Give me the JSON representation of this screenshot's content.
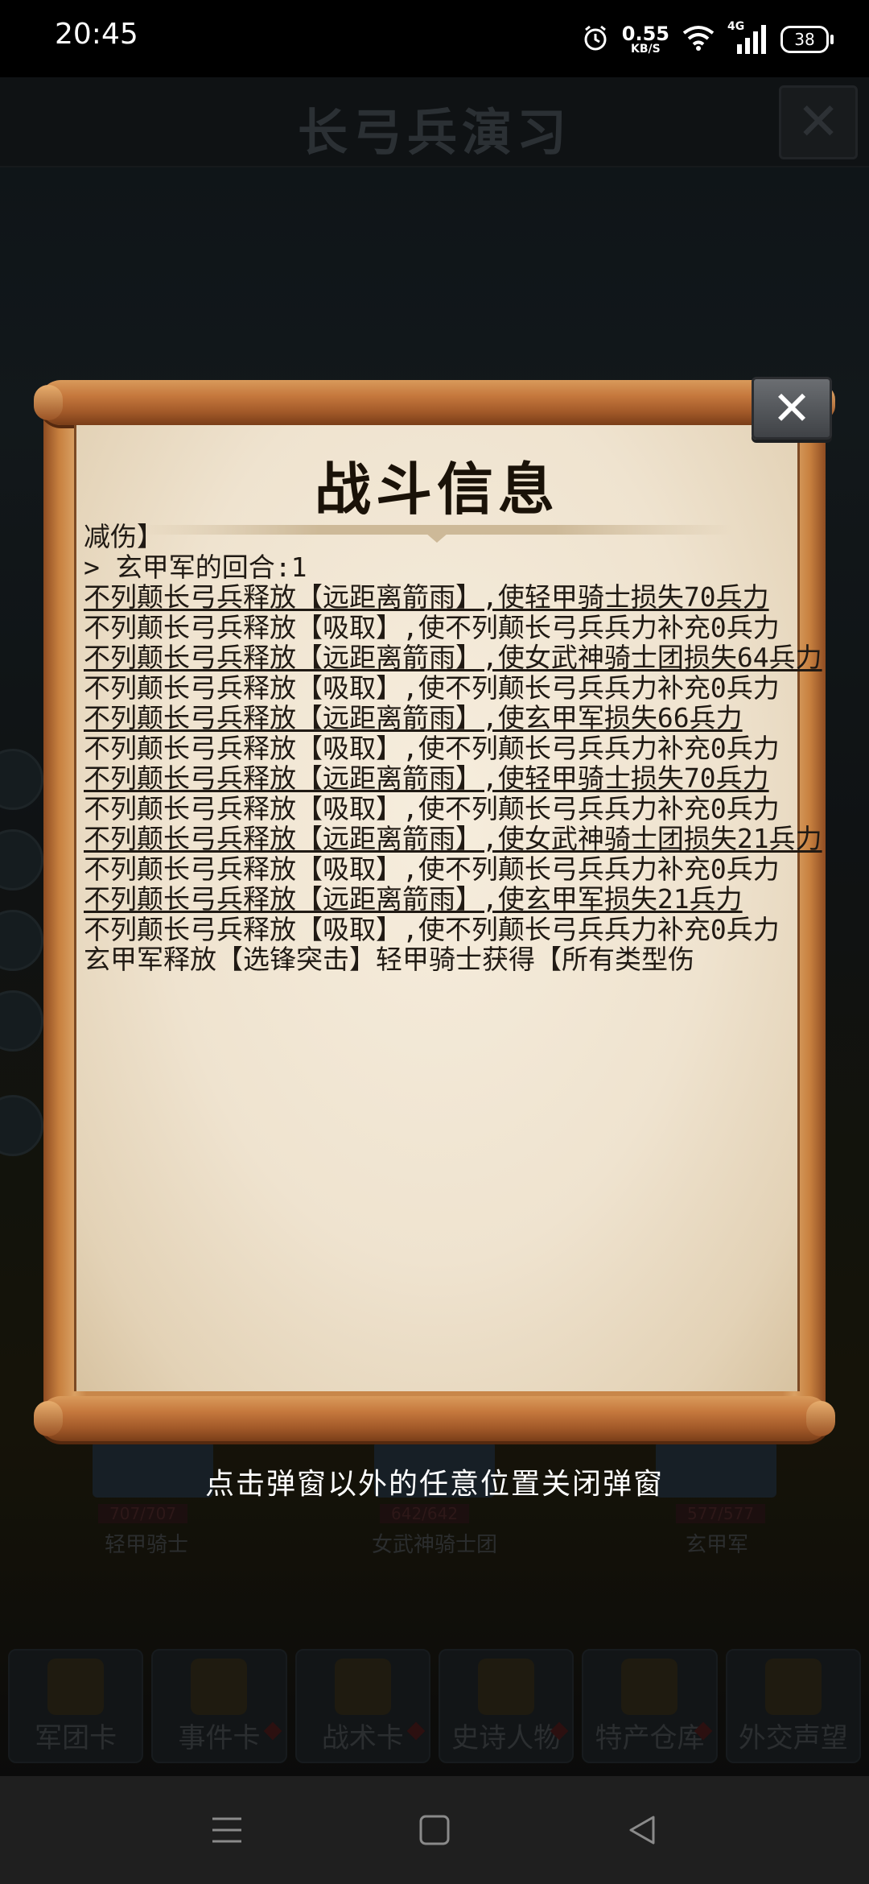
{
  "status_bar": {
    "time": "20:45",
    "net_speed_value": "0.55",
    "net_speed_unit": "KB/S",
    "network_type": "4G",
    "battery_level": "38"
  },
  "game": {
    "title": "长弓兵演习",
    "units": [
      {
        "hp": "707/707",
        "name": "轻甲骑士"
      },
      {
        "hp": "642/642",
        "name": "女武神骑士团"
      },
      {
        "hp": "577/577",
        "name": "玄甲军"
      }
    ],
    "menu": [
      "军团卡",
      "事件卡",
      "战术卡",
      "史诗人物",
      "特产仓库",
      "外交声望"
    ]
  },
  "dialog": {
    "title": "战斗信息",
    "close_icon": "close-x-icon",
    "log_lines": [
      {
        "text": "减伤】",
        "underline": false
      },
      {
        "text": "> 玄甲军的回合:1",
        "underline": false
      },
      {
        "text": "不列颠长弓兵释放【远距离箭雨】,使轻甲骑士损失70兵力",
        "underline": true
      },
      {
        "text": "不列颠长弓兵释放【吸取】,使不列颠长弓兵兵力补充0兵力",
        "underline": false
      },
      {
        "text": "不列颠长弓兵释放【远距离箭雨】,使女武神骑士团损失64兵力",
        "underline": true
      },
      {
        "text": "不列颠长弓兵释放【吸取】,使不列颠长弓兵兵力补充0兵力",
        "underline": false
      },
      {
        "text": "不列颠长弓兵释放【远距离箭雨】,使玄甲军损失66兵力",
        "underline": true
      },
      {
        "text": "不列颠长弓兵释放【吸取】,使不列颠长弓兵兵力补充0兵力",
        "underline": false
      },
      {
        "text": "不列颠长弓兵释放【远距离箭雨】,使轻甲骑士损失70兵力",
        "underline": true
      },
      {
        "text": "不列颠长弓兵释放【吸取】,使不列颠长弓兵兵力补充0兵力",
        "underline": false
      },
      {
        "text": "不列颠长弓兵释放【远距离箭雨】,使女武神骑士团损失21兵力",
        "underline": true
      },
      {
        "text": "不列颠长弓兵释放【吸取】,使不列颠长弓兵兵力补充0兵力",
        "underline": false
      },
      {
        "text": "不列颠长弓兵释放【远距离箭雨】,使玄甲军损失21兵力",
        "underline": true
      },
      {
        "text": "不列颠长弓兵释放【吸取】,使不列颠长弓兵兵力补充0兵力",
        "underline": false
      },
      {
        "text": "玄甲军释放【选锋突击】轻甲骑士获得【所有类型伤",
        "underline": false
      }
    ],
    "hint": "点击弹窗以外的任意位置关闭弹窗"
  },
  "navbar": {
    "icons": [
      "menu-icon",
      "home-square-icon",
      "back-triangle-icon"
    ]
  }
}
